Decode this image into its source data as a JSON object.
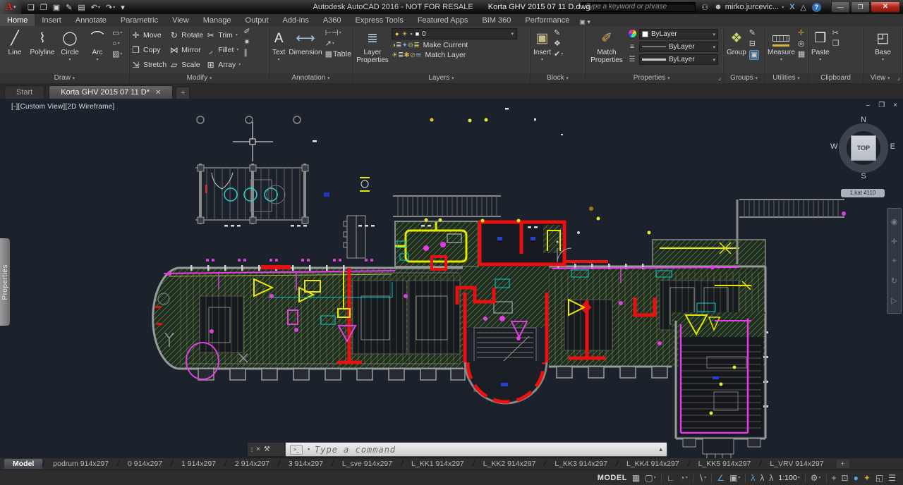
{
  "titlebar": {
    "app_title": "Autodesk AutoCAD 2016 - NOT FOR RESALE",
    "doc_title": "Korta GHV 2015 07 11 D.dwg",
    "search_placeholder": "Type a keyword or phrase",
    "username": "mirko.jurcevic...",
    "logo_glyph": "A",
    "qat_icons": [
      {
        "name": "new-file-icon",
        "glyph": "❏"
      },
      {
        "name": "open-file-icon",
        "glyph": "❐"
      },
      {
        "name": "save-icon",
        "glyph": "▣"
      },
      {
        "name": "save-as-icon",
        "glyph": "✎"
      },
      {
        "name": "plot-icon",
        "glyph": "▤"
      },
      {
        "name": "undo-icon",
        "glyph": "↶",
        "caret": true
      },
      {
        "name": "redo-icon",
        "glyph": "↷",
        "caret": true
      },
      {
        "name": "qat-customize-icon",
        "glyph": "▾"
      }
    ],
    "right_icons": [
      {
        "name": "search-binoculars-icon",
        "glyph": "⚇"
      },
      {
        "name": "avatar-icon",
        "glyph": "☻"
      },
      {
        "name": "exchange-apps-icon",
        "glyph": "X"
      },
      {
        "name": "a360-icon",
        "glyph": "△"
      }
    ],
    "help_glyph": "?",
    "win_controls": [
      {
        "name": "minimize-button",
        "glyph": "—"
      },
      {
        "name": "restore-button",
        "glyph": "❐"
      },
      {
        "name": "close-button",
        "glyph": "✕"
      }
    ]
  },
  "ribbon": {
    "active_tab": "Home",
    "tabs": [
      "Home",
      "Insert",
      "Annotate",
      "Parametric",
      "View",
      "Manage",
      "Output",
      "Add-ins",
      "A360",
      "Express Tools",
      "Featured Apps",
      "BIM 360",
      "Performance"
    ],
    "tab_end_glyph": "▣ ▾",
    "panels": {
      "draw": {
        "label": "Draw",
        "big": [
          {
            "label": "Line",
            "glyph": "╱"
          },
          {
            "label": "Polyline",
            "glyph": "⌇"
          },
          {
            "label": "Circle",
            "glyph": "◯",
            "caret": true
          },
          {
            "label": "Arc",
            "glyph": "⌒",
            "caret": true
          }
        ],
        "small": [
          {
            "name": "rectangle-icon",
            "glyph": "▭",
            "caret": true
          },
          {
            "name": "ellipse-icon",
            "glyph": "○",
            "caret": true
          },
          {
            "name": "hatch-icon",
            "glyph": "▨",
            "caret": true
          }
        ]
      },
      "modify": {
        "label": "Modify",
        "grid": [
          {
            "label": "Move",
            "glyph": "✛"
          },
          {
            "label": "Copy",
            "glyph": "❐"
          },
          {
            "label": "Stretch",
            "glyph": "⇲"
          },
          {
            "label": "Rotate",
            "glyph": "↻"
          },
          {
            "label": "Mirror",
            "glyph": "⋈"
          },
          {
            "label": "Scale",
            "glyph": "▱"
          },
          {
            "label": "Trim",
            "glyph": "✂",
            "caret": true
          },
          {
            "label": "Fillet",
            "glyph": "◞",
            "caret": true
          },
          {
            "label": "Array",
            "glyph": "⊞",
            "caret": true
          }
        ],
        "side": [
          {
            "name": "erase-icon",
            "glyph": "✐"
          },
          {
            "name": "explode-icon",
            "glyph": "✷"
          },
          {
            "name": "offset-icon",
            "glyph": "∥"
          }
        ]
      },
      "annotation": {
        "label": "Annotation",
        "text_btn": {
          "label": "Text",
          "glyph": "A",
          "caret": true
        },
        "dim_btn": {
          "label": "Dimension",
          "glyph": "⟷"
        },
        "small": [
          {
            "name": "dimension-linear-icon",
            "glyph": "⊢⊣",
            "caret": true
          },
          {
            "name": "leader-icon",
            "glyph": "↗",
            "caret": true
          },
          {
            "name": "table-icon",
            "glyph": "▦",
            "label": "Table"
          }
        ]
      },
      "layers": {
        "label": "Layers",
        "properties_btn": "Layer Properties",
        "properties_glyph": "≣",
        "combo": {
          "value": "0",
          "icons": [
            {
              "name": "layer-bulb-icon",
              "glyph": "●",
              "color": "#e8c83c"
            },
            {
              "name": "layer-sun-icon",
              "glyph": "☀",
              "color": "#e8c83c"
            },
            {
              "name": "layer-lock-icon",
              "glyph": "▪",
              "color": "#a8a8a8"
            },
            {
              "name": "layer-color-swatch",
              "glyph": "■",
              "color": "#ffffff"
            }
          ]
        },
        "row1_icons": [
          {
            "name": "layer-off-icon",
            "glyph": "◑",
            "color": "#c8b060"
          },
          {
            "name": "layer-isolate-icon",
            "glyph": "≣",
            "color": "#bcbcbc"
          },
          {
            "name": "layer-freeze-icon",
            "glyph": "✦",
            "color": "#86a8c8"
          },
          {
            "name": "layer-lock-tool-icon",
            "glyph": "⊖",
            "color": "#9ec07e"
          },
          {
            "name": "layer-make-current-icon",
            "glyph": "≣",
            "color": "#d0c060"
          }
        ],
        "row2_icons": [
          {
            "name": "layer-on-all-icon",
            "glyph": "☀",
            "color": "#d0c060"
          },
          {
            "name": "layer-unisolate-icon",
            "glyph": "≣",
            "color": "#bcbcbc"
          },
          {
            "name": "layer-thaw-icon",
            "glyph": "✱",
            "color": "#d0b050"
          },
          {
            "name": "layer-unlock-icon",
            "glyph": "⊘",
            "color": "#c09060"
          },
          {
            "name": "layer-match-icon",
            "glyph": "≋",
            "color": "#86a8c8"
          }
        ],
        "make_current": "Make Current",
        "match_layer": "Match Layer"
      },
      "block": {
        "label": "Block",
        "insert_btn": {
          "label": "Insert",
          "glyph": "▣",
          "caret": true
        },
        "small": [
          {
            "name": "edit-block-icon",
            "glyph": "✎"
          },
          {
            "name": "create-block-icon",
            "glyph": "❖"
          },
          {
            "name": "block-attributes-icon",
            "glyph": "✔",
            "caret": true
          }
        ]
      },
      "properties": {
        "label": "Properties",
        "expander_glyph": "⌟",
        "match_btn": "Match Properties",
        "match_glyph": "✐",
        "combos": [
          {
            "name": "object-color-combo",
            "value": "ByLayer",
            "kind": "color"
          },
          {
            "name": "linetype-combo",
            "value": "ByLayer",
            "kind": "line"
          },
          {
            "name": "lineweight-combo",
            "value": "ByLayer",
            "kind": "thick"
          }
        ]
      },
      "groups": {
        "label": "Groups",
        "group_btn": {
          "label": "Group",
          "glyph": "❖"
        },
        "small": [
          {
            "name": "ungroup-icon",
            "glyph": "✎"
          },
          {
            "name": "group-edit-icon",
            "glyph": "⊟"
          },
          {
            "name": "group-select-icon",
            "glyph": "▣",
            "sel": true
          }
        ]
      },
      "utilities": {
        "label": "Utilities",
        "measure_btn": {
          "label": "Measure",
          "caret": true
        },
        "small": [
          {
            "name": "id-point-icon",
            "glyph": "✛",
            "color": "#c8a030"
          },
          {
            "name": "point-style-icon",
            "glyph": "◎"
          },
          {
            "name": "quick-calc-icon",
            "glyph": "▦"
          }
        ]
      },
      "clipboard": {
        "label": "Clipboard",
        "paste_btn": {
          "label": "Paste",
          "glyph": "❒",
          "caret": true
        },
        "small": [
          {
            "name": "cut-icon",
            "glyph": "✂"
          },
          {
            "name": "copy-clip-icon",
            "glyph": "❐"
          }
        ]
      },
      "view": {
        "label": "View",
        "expander_glyph": "⌟",
        "base_btn": {
          "label": "Base",
          "glyph": "◰",
          "caret": true
        }
      }
    }
  },
  "file_tabs": {
    "start": "Start",
    "doc": "Korta GHV 2015 07 11 D*",
    "close_glyph": "✕",
    "add_glyph": "+"
  },
  "viewport": {
    "label": "[-][Custom View][2D Wireframe]",
    "viewcube": {
      "n": "N",
      "w": "W",
      "e": "E",
      "s": "S",
      "top": "TOP"
    },
    "badge": "1.kat 4110",
    "properties_tab": "Properties",
    "nav_icons": [
      {
        "name": "steering-wheel-icon",
        "glyph": "◉"
      },
      {
        "name": "pan-icon",
        "glyph": "✛"
      },
      {
        "name": "zoom-icon",
        "glyph": "⌖"
      },
      {
        "name": "orbit-icon",
        "glyph": "↻"
      },
      {
        "name": "showmotion-icon",
        "glyph": "▷"
      }
    ],
    "win_controls": [
      {
        "name": "viewport-minimize-icon",
        "glyph": "–"
      },
      {
        "name": "viewport-restore-icon",
        "glyph": "❐"
      },
      {
        "name": "viewport-close-icon",
        "glyph": "×"
      }
    ]
  },
  "command_line": {
    "placeholder": "Type a command",
    "prompt_glyph": ">_",
    "grip_glyph": "⁞⁞",
    "close_glyph": "×",
    "wrench_glyph": "⚒",
    "recent_glyph": "▴",
    "caret": "▾"
  },
  "layout_tabs": {
    "active": "Model",
    "add_label": "+",
    "items": [
      "Model",
      "podrum 914x297",
      "0 914x297",
      "1 914x297",
      "2 914x297",
      "3 914x297",
      "L_sve 914x297",
      "L_KK1 914x297",
      "L_KK2 914x297",
      "L_KK3 914x297",
      "L_KK4 914x297",
      "L_KK5 914x297",
      "L_VRV 914x297"
    ]
  },
  "status_bar": {
    "model_label": "MODEL",
    "icons": [
      {
        "name": "grid-icon",
        "glyph": "▦"
      },
      {
        "name": "snap-icon",
        "glyph": "▢",
        "caret": true
      },
      {
        "name": "ortho-icon",
        "glyph": "∟",
        "sep": true
      },
      {
        "name": "polar-tracking-icon",
        "glyph": "◔",
        "active": true,
        "caret": true
      },
      {
        "name": "isodraft-icon",
        "glyph": "∖",
        "caret": true,
        "sep": true
      },
      {
        "name": "osnap-tracking-icon",
        "glyph": "∠",
        "active": true,
        "sep": true
      },
      {
        "name": "osnap-icon",
        "glyph": "▣",
        "caret": true
      },
      {
        "name": "annotation-visibility-icon",
        "glyph": "λ",
        "active": true,
        "sep": true
      },
      {
        "name": "annotation-autoscale-icon",
        "glyph": "λ"
      },
      {
        "name": "annotation-scale-icon",
        "glyph": "λ"
      },
      {
        "name": "scale-value",
        "text": "1:100",
        "caret": true
      },
      {
        "name": "workspace-gear-icon",
        "glyph": "⚙",
        "caret": true,
        "sep": true
      },
      {
        "name": "customize-plus-icon",
        "glyph": "+",
        "sep": true
      },
      {
        "name": "units-icon",
        "glyph": "⊡"
      },
      {
        "name": "hardware-accel-icon",
        "glyph": "●",
        "active": true
      },
      {
        "name": "isolate-objects-icon",
        "glyph": "✦",
        "color": "#d2a43c"
      },
      {
        "name": "clean-screen-icon",
        "glyph": "◱"
      },
      {
        "name": "status-menu-icon",
        "glyph": "☰"
      }
    ]
  },
  "colors": {
    "titlebar_bg": "#1f1f1f",
    "ribbon_bg": "#3a3a3a",
    "canvas_bg": "#1c222b",
    "accent_red": "#c8281e",
    "hatch_green": "#4aa04a",
    "duct_red": "#e81010",
    "duct_magenta": "#e83ae8",
    "duct_yellow": "#e8e800",
    "duct_cyan": "#00d0d0",
    "wall_gray": "#9a9a9a",
    "active_blue": "#58a6e0"
  }
}
